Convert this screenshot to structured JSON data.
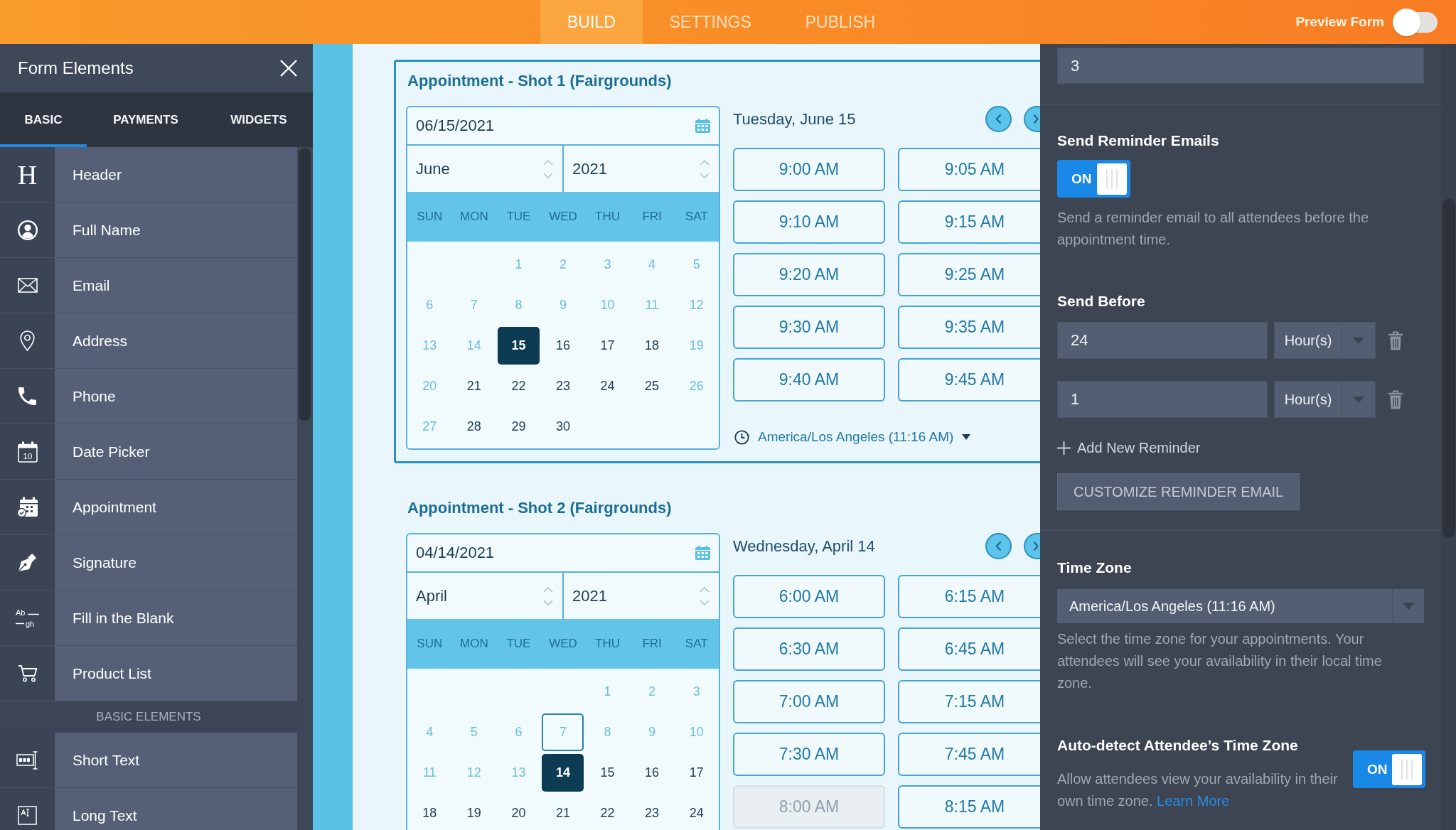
{
  "top_bar": {
    "tabs": [
      {
        "label": "BUILD",
        "selected": true
      },
      {
        "label": "SETTINGS",
        "selected": false
      },
      {
        "label": "PUBLISH",
        "selected": false
      }
    ],
    "preview_form": {
      "label": "Preview Form",
      "on": false
    }
  },
  "sidebar": {
    "title": "Form Elements",
    "tabs": [
      {
        "label": "BASIC",
        "selected": true
      },
      {
        "label": "PAYMENTS",
        "selected": false
      },
      {
        "label": "WIDGETS",
        "selected": false
      }
    ],
    "items": [
      {
        "label": "Header",
        "icon_text": [
          "H"
        ]
      },
      {
        "label": "Full Name"
      },
      {
        "label": "Email"
      },
      {
        "label": "Address"
      },
      {
        "label": "Phone"
      },
      {
        "label": "Date Picker",
        "icon_text": [
          "10"
        ]
      },
      {
        "label": "Appointment"
      },
      {
        "label": "Signature"
      },
      {
        "label": "Fill in the Blank",
        "icon_text": [
          "Ab",
          "gh"
        ]
      },
      {
        "label": "Product List"
      }
    ],
    "section": {
      "heading": "BASIC ELEMENTS",
      "items": [
        {
          "label": "Short Text"
        },
        {
          "label": "Long Text"
        }
      ]
    }
  },
  "appointments": [
    {
      "title": "Appointment - Shot 1 (Fairgrounds)",
      "selected": true,
      "date": "06/15/2021",
      "month": "June",
      "year": "2021",
      "weekdays": [
        "SUN",
        "MON",
        "TUE",
        "WED",
        "THU",
        "FRI",
        "SAT"
      ],
      "weeks": [
        {
          "right_aligned": true,
          "days": [
            {
              "day": "1",
              "available": false,
              "selected": false,
              "outlined": false
            },
            {
              "day": "2",
              "available": false,
              "selected": false,
              "outlined": false
            },
            {
              "day": "3",
              "available": false,
              "selected": false,
              "outlined": false
            },
            {
              "day": "4",
              "available": false,
              "selected": false,
              "outlined": false
            },
            {
              "day": "5",
              "available": false,
              "selected": false,
              "outlined": false
            }
          ]
        },
        {
          "days": [
            {
              "day": "6",
              "available": false,
              "selected": false,
              "outlined": false
            },
            {
              "day": "7",
              "available": false,
              "selected": false,
              "outlined": false
            },
            {
              "day": "8",
              "available": false,
              "selected": false,
              "outlined": false
            },
            {
              "day": "9",
              "available": false,
              "selected": false,
              "outlined": false
            },
            {
              "day": "10",
              "available": false,
              "selected": false,
              "outlined": false
            },
            {
              "day": "11",
              "available": false,
              "selected": false,
              "outlined": false
            },
            {
              "day": "12",
              "available": false,
              "selected": false,
              "outlined": false
            }
          ]
        },
        {
          "days": [
            {
              "day": "13",
              "available": false,
              "selected": false,
              "outlined": false
            },
            {
              "day": "14",
              "available": false,
              "selected": false,
              "outlined": false
            },
            {
              "day": "15",
              "available": true,
              "selected": true,
              "outlined": false
            },
            {
              "day": "16",
              "available": true,
              "selected": false,
              "outlined": false
            },
            {
              "day": "17",
              "available": true,
              "selected": false,
              "outlined": false
            },
            {
              "day": "18",
              "available": true,
              "selected": false,
              "outlined": false
            },
            {
              "day": "19",
              "available": false,
              "selected": false,
              "outlined": false
            }
          ]
        },
        {
          "days": [
            {
              "day": "20",
              "available": false,
              "selected": false,
              "outlined": false
            },
            {
              "day": "21",
              "available": true,
              "selected": false,
              "outlined": false
            },
            {
              "day": "22",
              "available": true,
              "selected": false,
              "outlined": false
            },
            {
              "day": "23",
              "available": true,
              "selected": false,
              "outlined": false
            },
            {
              "day": "24",
              "available": true,
              "selected": false,
              "outlined": false
            },
            {
              "day": "25",
              "available": true,
              "selected": false,
              "outlined": false
            },
            {
              "day": "26",
              "available": false,
              "selected": false,
              "outlined": false
            }
          ]
        },
        {
          "right_aligned": false,
          "days": [
            {
              "day": "27",
              "available": false,
              "selected": false,
              "outlined": false
            },
            {
              "day": "28",
              "available": true,
              "selected": false,
              "outlined": false
            },
            {
              "day": "29",
              "available": true,
              "selected": false,
              "outlined": false
            },
            {
              "day": "30",
              "available": true,
              "selected": false,
              "outlined": false
            }
          ]
        }
      ],
      "day_heading": "Tuesday, June 15",
      "slots": [
        {
          "time": "9:00 AM",
          "disabled": false
        },
        {
          "time": "9:05 AM",
          "disabled": false
        },
        {
          "time": "9:10 AM",
          "disabled": false
        },
        {
          "time": "9:15 AM",
          "disabled": false
        },
        {
          "time": "9:20 AM",
          "disabled": false
        },
        {
          "time": "9:25 AM",
          "disabled": false
        },
        {
          "time": "9:30 AM",
          "disabled": false
        },
        {
          "time": "9:35 AM",
          "disabled": false
        },
        {
          "time": "9:40 AM",
          "disabled": false
        },
        {
          "time": "9:45 AM",
          "disabled": false
        }
      ],
      "timezone": "America/Los Angeles (11:16 AM)"
    },
    {
      "title": "Appointment - Shot 2 (Fairgrounds)",
      "selected": false,
      "date": "04/14/2021",
      "month": "April",
      "year": "2021",
      "weekdays": [
        "SUN",
        "MON",
        "TUE",
        "WED",
        "THU",
        "FRI",
        "SAT"
      ],
      "weeks": [
        {
          "right_aligned": true,
          "days": [
            {
              "day": "1",
              "available": false,
              "selected": false,
              "outlined": false
            },
            {
              "day": "2",
              "available": false,
              "selected": false,
              "outlined": false
            },
            {
              "day": "3",
              "available": false,
              "selected": false,
              "outlined": false
            }
          ]
        },
        {
          "days": [
            {
              "day": "4",
              "available": false,
              "selected": false,
              "outlined": false
            },
            {
              "day": "5",
              "available": false,
              "selected": false,
              "outlined": false
            },
            {
              "day": "6",
              "available": false,
              "selected": false,
              "outlined": false
            },
            {
              "day": "7",
              "available": false,
              "selected": false,
              "outlined": true
            },
            {
              "day": "8",
              "available": false,
              "selected": false,
              "outlined": false
            },
            {
              "day": "9",
              "available": false,
              "selected": false,
              "outlined": false
            },
            {
              "day": "10",
              "available": false,
              "selected": false,
              "outlined": false
            }
          ]
        },
        {
          "days": [
            {
              "day": "11",
              "available": false,
              "selected": false,
              "outlined": false
            },
            {
              "day": "12",
              "available": false,
              "selected": false,
              "outlined": false
            },
            {
              "day": "13",
              "available": false,
              "selected": false,
              "outlined": false
            },
            {
              "day": "14",
              "available": true,
              "selected": true,
              "outlined": false
            },
            {
              "day": "15",
              "available": true,
              "selected": false,
              "outlined": false
            },
            {
              "day": "16",
              "available": true,
              "selected": false,
              "outlined": false
            },
            {
              "day": "17",
              "available": true,
              "selected": false,
              "outlined": false
            }
          ]
        },
        {
          "days": [
            {
              "day": "18",
              "available": true,
              "selected": false,
              "outlined": false
            },
            {
              "day": "19",
              "available": true,
              "selected": false,
              "outlined": false
            },
            {
              "day": "20",
              "available": true,
              "selected": false,
              "outlined": false
            },
            {
              "day": "21",
              "available": true,
              "selected": false,
              "outlined": false
            },
            {
              "day": "22",
              "available": true,
              "selected": false,
              "outlined": false
            },
            {
              "day": "23",
              "available": true,
              "selected": false,
              "outlined": false
            },
            {
              "day": "24",
              "available": true,
              "selected": false,
              "outlined": false
            }
          ]
        }
      ],
      "day_heading": "Wednesday, April 14",
      "slots": [
        {
          "time": "6:00 AM",
          "disabled": false
        },
        {
          "time": "6:15 AM",
          "disabled": false
        },
        {
          "time": "6:30 AM",
          "disabled": false
        },
        {
          "time": "6:45 AM",
          "disabled": false
        },
        {
          "time": "7:00 AM",
          "disabled": false
        },
        {
          "time": "7:15 AM",
          "disabled": false
        },
        {
          "time": "7:30 AM",
          "disabled": false
        },
        {
          "time": "7:45 AM",
          "disabled": false
        },
        {
          "time": "8:00 AM",
          "disabled": true
        },
        {
          "time": "8:15 AM",
          "disabled": false
        }
      ]
    }
  ],
  "properties": {
    "top_field": {
      "value": "3"
    },
    "reminder_emails": {
      "title": "Send Reminder Emails",
      "toggle": {
        "label": "ON",
        "on": true
      },
      "description": "Send a reminder email to all attendees before the appointment time."
    },
    "send_before": {
      "title": "Send Before",
      "rows": [
        {
          "value": "24",
          "unit": "Hour(s)"
        },
        {
          "value": "1",
          "unit": "Hour(s)"
        }
      ],
      "add_label": "Add New Reminder",
      "customize_button": "CUSTOMIZE REMINDER EMAIL"
    },
    "time_zone": {
      "title": "Time Zone",
      "value": "America/Los Angeles (11:16 AM)",
      "description": "Select the time zone for your appointments. Your attendees will see your availability in their local time zone."
    },
    "auto_detect": {
      "title": "Auto-detect Attendee’s Time Zone",
      "description": "Allow attendees view your availability in their own time zone.",
      "link": "Learn More",
      "toggle": {
        "label": "ON",
        "on": true
      }
    }
  }
}
